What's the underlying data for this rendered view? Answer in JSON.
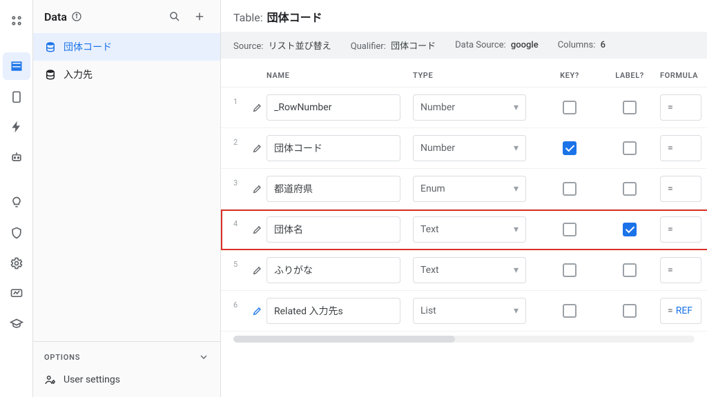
{
  "sidebar": {
    "title": "Data",
    "tables": [
      {
        "label": "団体コード",
        "active": true
      },
      {
        "label": "入力先",
        "active": false
      }
    ],
    "options_label": "OPTIONS",
    "user_settings_label": "User settings"
  },
  "header": {
    "table_prefix": "Table:",
    "table_name": "団体コード"
  },
  "meta": {
    "source_label": "Source:",
    "source_value": "リスト並び替え",
    "qualifier_label": "Qualifier:",
    "qualifier_value": "団体コード",
    "datasource_label": "Data Source:",
    "datasource_value": "google",
    "columns_label": "Columns:",
    "columns_value": "6"
  },
  "columns_header": {
    "name": "NAME",
    "type": "TYPE",
    "key": "KEY?",
    "label": "LABEL?",
    "formula": "FORMULA"
  },
  "rows": [
    {
      "idx": "1",
      "name": "_RowNumber",
      "type": "Number",
      "key": false,
      "label": false,
      "formula": "=",
      "virtual": false,
      "highlight": false
    },
    {
      "idx": "2",
      "name": "団体コード",
      "type": "Number",
      "key": true,
      "label": false,
      "formula": "=",
      "virtual": false,
      "highlight": false
    },
    {
      "idx": "3",
      "name": "都道府県",
      "type": "Enum",
      "key": false,
      "label": false,
      "formula": "=",
      "virtual": false,
      "highlight": false
    },
    {
      "idx": "4",
      "name": "団体名",
      "type": "Text",
      "key": false,
      "label": true,
      "formula": "=",
      "virtual": false,
      "highlight": true
    },
    {
      "idx": "5",
      "name": "ふりがな",
      "type": "Text",
      "key": false,
      "label": false,
      "formula": "=",
      "virtual": false,
      "highlight": false
    },
    {
      "idx": "6",
      "name": "Related 入力先s",
      "type": "List",
      "key": false,
      "label": false,
      "formula": "=",
      "formula_extra": "REF",
      "virtual": true,
      "highlight": false
    }
  ]
}
